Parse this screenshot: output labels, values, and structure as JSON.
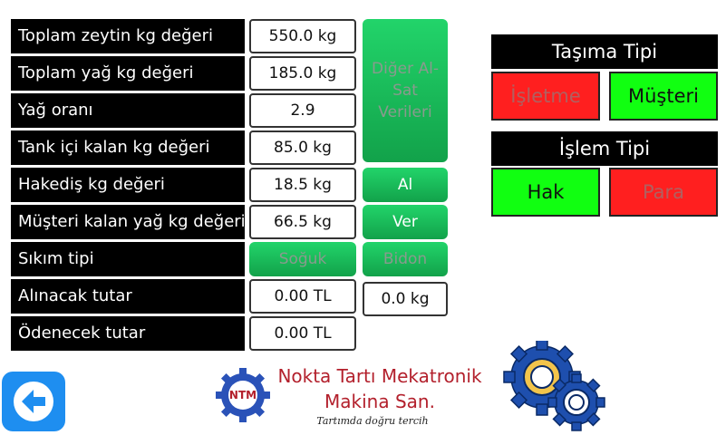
{
  "rows": [
    {
      "label": "Toplam zeytin kg değeri",
      "value": "550.0 kg"
    },
    {
      "label": "Toplam yağ kg değeri",
      "value": "185.0 kg"
    },
    {
      "label": "Yağ oranı",
      "value": "2.9"
    },
    {
      "label": "Tank içi kalan kg değeri",
      "value": "85.0 kg"
    },
    {
      "label": "Hakediş kg değeri",
      "value": "18.5 kg"
    },
    {
      "label": "Müşteri kalan yağ kg değeri",
      "value": "66.5 kg"
    },
    {
      "label": "Sıkım tipi",
      "value": "Soğuk"
    },
    {
      "label": "Alınacak tutar",
      "value": "0.00 TL"
    },
    {
      "label": "Ödenecek tutar",
      "value": "0.00 TL"
    }
  ],
  "buttons": {
    "diger": "Diğer Al-Sat Verileri",
    "al": "Al",
    "ver": "Ver",
    "bidon": "Bidon",
    "extra_value": "0.0 kg"
  },
  "tasima": {
    "title": "Taşıma Tipi",
    "option1": "İşletme",
    "option2": "Müşteri"
  },
  "islem": {
    "title": "İşlem Tipi",
    "option1": "Hak",
    "option2": "Para"
  },
  "logo": {
    "mark": "NTM",
    "line1": "Nokta Tartı Mekatronik",
    "line2": "Makina San.",
    "slogan": "Tartımda doğru tercih"
  },
  "colors": {
    "accent_green": "#1fc45e",
    "active_green": "#11ff11",
    "inactive_red": "#ff1f1f",
    "back_blue": "#1e8ef0"
  },
  "icons": {
    "back": "back-arrow-icon",
    "settings": "gears-icon"
  }
}
